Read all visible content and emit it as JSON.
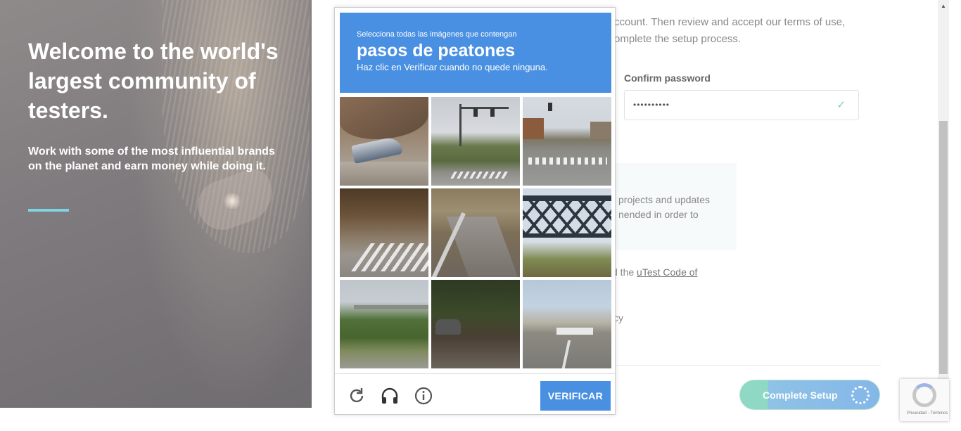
{
  "hero": {
    "title": "Welcome to the world's largest community of testers.",
    "subtitle": "Work with some of the most influential brands on the planet and earn money while doing it.",
    "accent_color": "#7fd3e3"
  },
  "form": {
    "intro_line1": "ccount. Then review and accept our terms of use,",
    "intro_line2": "omplete the setup process.",
    "confirm_password_label": "Confirm password",
    "confirm_password_value": "••••••••••",
    "notice_text": "projects and updates nended in order to",
    "code_prefix": "d the ",
    "code_link": "uTest Code of",
    "privacy_fragment": "cy",
    "complete_button": "Complete Setup"
  },
  "captcha": {
    "instruction_small": "Selecciona todas las imágenes que contengan",
    "target": "pasos de peatones",
    "hint": "Haz clic en Verificar cuando no quede ninguna.",
    "verify_label": "VERIFICAR",
    "header_color": "#4a90e2",
    "tools": [
      "reload-icon",
      "headphones-icon",
      "info-icon"
    ]
  },
  "recaptcha_badge": {
    "text": "Privacidad - Términos"
  }
}
